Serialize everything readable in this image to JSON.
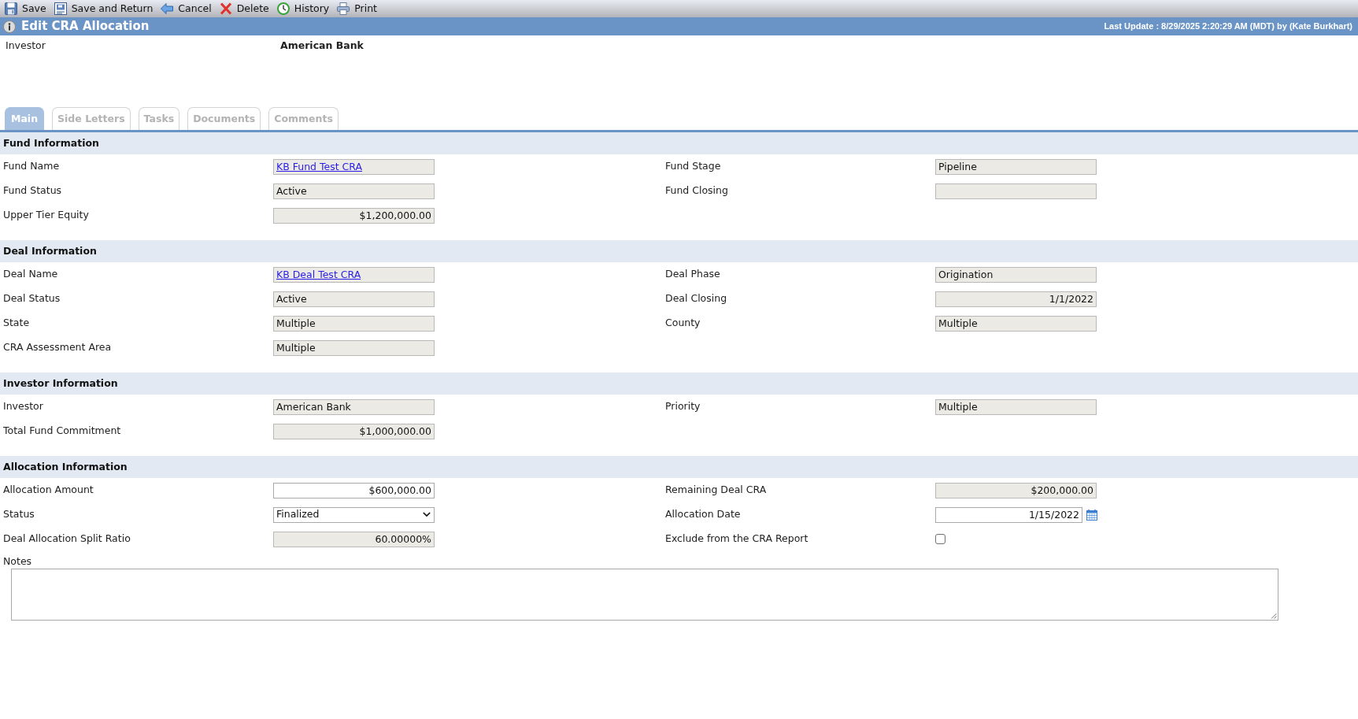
{
  "toolbar": [
    {
      "label": "Save",
      "kind": "save"
    },
    {
      "label": "Save and Return",
      "kind": "save-return"
    },
    {
      "label": "Cancel",
      "kind": "cancel"
    },
    {
      "label": "Delete",
      "kind": "delete"
    },
    {
      "label": "History",
      "kind": "history"
    },
    {
      "label": "Print",
      "kind": "print"
    }
  ],
  "header": {
    "title": "Edit CRA Allocation",
    "last_update": "Last Update : 8/29/2025 2:20:29 AM (MDT) by (Kate Burkhart)"
  },
  "summary": {
    "label": "Investor",
    "value": "American Bank"
  },
  "tabs": [
    {
      "label": "Main",
      "selected": true
    },
    {
      "label": "Side Letters",
      "selected": false
    },
    {
      "label": "Tasks",
      "selected": false
    },
    {
      "label": "Documents",
      "selected": false
    },
    {
      "label": "Comments",
      "selected": false
    }
  ],
  "sections": [
    {
      "title": "Fund Information",
      "rows": [
        [
          {
            "label": "Fund Name",
            "value": "KB Fund Test CRA",
            "kind": "link"
          },
          {
            "label": "Fund Stage",
            "value": "Pipeline",
            "kind": "text"
          }
        ],
        [
          {
            "label": "Fund Status",
            "value": "Active",
            "kind": "text"
          },
          {
            "label": "Fund Closing",
            "kind": "text"
          }
        ],
        [
          {
            "label": "Upper Tier Equity",
            "value": "$1,200,000.00",
            "kind": "number"
          }
        ]
      ]
    },
    {
      "title": "Deal Information",
      "rows": [
        [
          {
            "label": "Deal Name",
            "value": "KB Deal Test CRA",
            "kind": "link"
          },
          {
            "label": "Deal Phase",
            "value": "Origination",
            "kind": "text"
          }
        ],
        [
          {
            "label": "Deal Status",
            "value": "Active",
            "kind": "text"
          },
          {
            "label": "Deal Closing",
            "value": "1/1/2022",
            "kind": "number"
          }
        ],
        [
          {
            "label": "State",
            "value": "Multiple",
            "kind": "text"
          },
          {
            "label": "County",
            "value": "Multiple",
            "kind": "text"
          }
        ],
        [
          {
            "label": "CRA Assessment Area",
            "value": "Multiple",
            "kind": "text"
          }
        ]
      ]
    },
    {
      "title": "Investor Information",
      "rows": [
        [
          {
            "label": "Investor",
            "value": "American Bank",
            "kind": "text"
          },
          {
            "label": "Priority",
            "value": "Multiple",
            "kind": "text"
          }
        ],
        [
          {
            "label": "Total Fund Commitment",
            "value": "$1,000,000.00",
            "kind": "number"
          }
        ]
      ]
    },
    {
      "title": "Allocation Information",
      "rows": [
        [
          {
            "label": "Allocation Amount",
            "value": "$600,000.00",
            "kind": "input"
          },
          {
            "label": "Remaining Deal CRA",
            "value": "$200,000.00",
            "kind": "number"
          }
        ],
        [
          {
            "label": "Status",
            "value": "Finalized",
            "kind": "select"
          },
          {
            "label": "Allocation Date",
            "value": "1/15/2022",
            "kind": "date"
          }
        ],
        [
          {
            "label": "Deal Allocation Split Ratio",
            "value": "60.00000%",
            "kind": "number"
          },
          {
            "label": "Exclude from the CRA Report",
            "kind": "checkbox",
            "checked": false
          }
        ]
      ],
      "notes": {
        "label": "Notes"
      }
    }
  ]
}
